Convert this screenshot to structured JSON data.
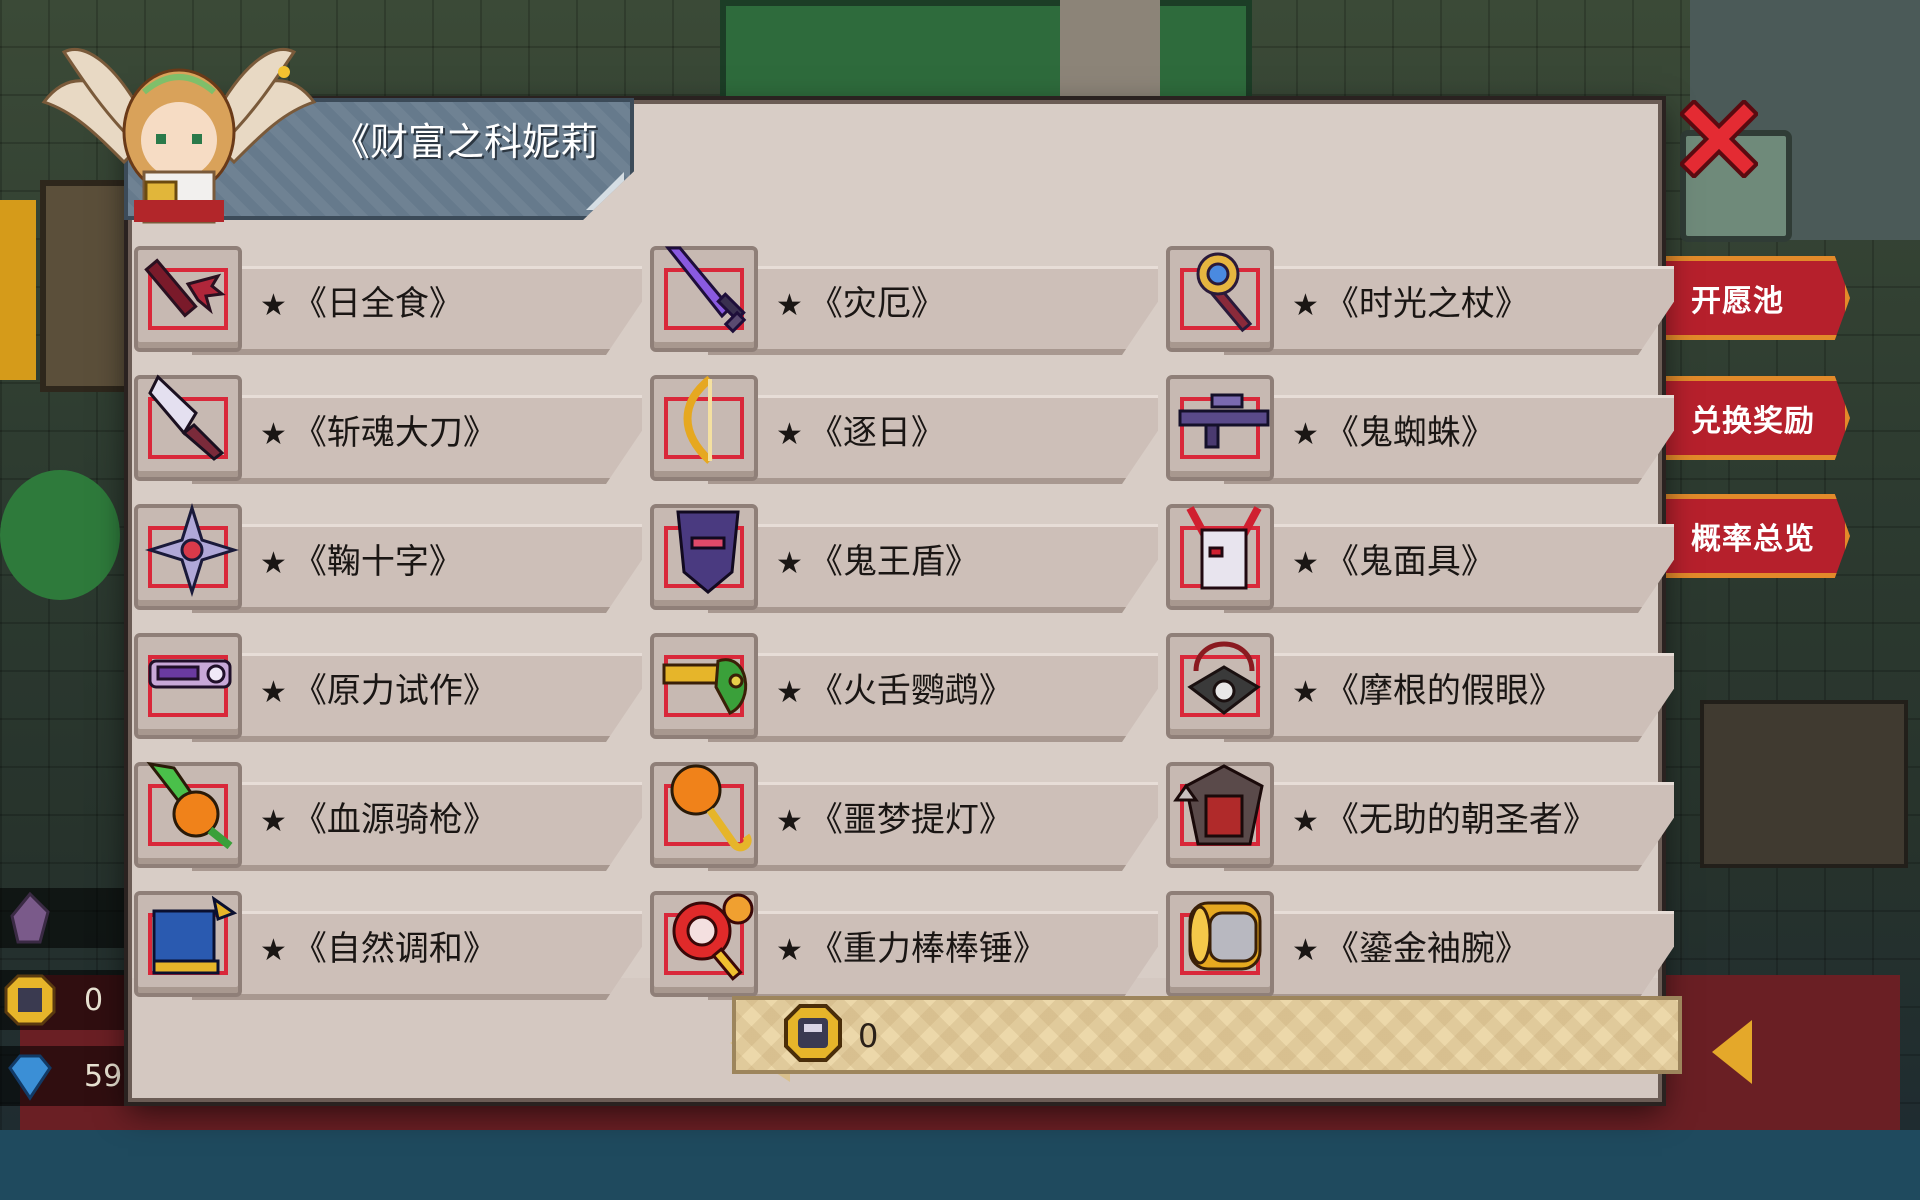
{
  "dialog": {
    "title": "《财富之科妮莉",
    "close_icon": "close-icon"
  },
  "items": [
    {
      "label": "《日全食》",
      "icon": "dark-trident-icon"
    },
    {
      "label": "《灾厄》",
      "icon": "purple-sword-icon"
    },
    {
      "label": "《时光之杖》",
      "icon": "clock-staff-icon"
    },
    {
      "label": "《斩魂大刀》",
      "icon": "great-blade-icon"
    },
    {
      "label": "《逐日》",
      "icon": "golden-bow-icon"
    },
    {
      "label": "《鬼蜘蛛》",
      "icon": "sniper-rifle-icon"
    },
    {
      "label": "《鞠十字》",
      "icon": "shuriken-icon"
    },
    {
      "label": "《鬼王盾》",
      "icon": "demon-shield-icon"
    },
    {
      "label": "《鬼面具》",
      "icon": "horned-mask-icon"
    },
    {
      "label": "《原力试作》",
      "icon": "force-gun-icon"
    },
    {
      "label": "《火舌鹦鹉》",
      "icon": "parrot-pistol-icon"
    },
    {
      "label": "《摩根的假眼》",
      "icon": "eye-amulet-icon"
    },
    {
      "label": "《血源骑枪》",
      "icon": "pumpkin-lance-icon"
    },
    {
      "label": "《噩梦提灯》",
      "icon": "pumpkin-lantern-icon"
    },
    {
      "label": "《无助的朝圣者》",
      "icon": "spiked-armor-icon"
    },
    {
      "label": "《自然调和》",
      "icon": "winged-boots-icon"
    },
    {
      "label": "《重力棒棒锤》",
      "icon": "lollipop-hammer-icon"
    },
    {
      "label": "《鎏金袖腕》",
      "icon": "golden-bracer-icon"
    }
  ],
  "star": "★",
  "currency": {
    "value": "0",
    "icon": "coin-token-icon"
  },
  "background": {
    "side_tabs": [
      "开愿池",
      "兑换奖励",
      "概率总览"
    ],
    "resources": [
      {
        "icon": "crystal-icon",
        "value": ""
      },
      {
        "icon": "coin-token-icon",
        "value": "0"
      },
      {
        "icon": "diamond-icon",
        "value": "59"
      }
    ]
  }
}
